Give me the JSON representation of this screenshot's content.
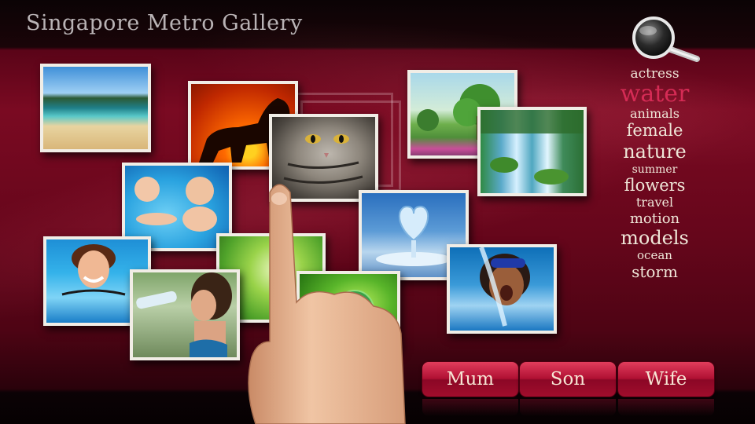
{
  "app": {
    "title": "Singapore Metro Gallery"
  },
  "search": {
    "icon": "magnifier-icon"
  },
  "photos": [
    {
      "name": "photo-beach",
      "icon": "beach-photo"
    },
    {
      "name": "photo-lion-sunset",
      "icon": "lion-photo"
    },
    {
      "name": "photo-cat",
      "icon": "cat-photo"
    },
    {
      "name": "photo-painting-trees",
      "icon": "trees-painting-photo"
    },
    {
      "name": "photo-waterfall",
      "icon": "waterfall-photo"
    },
    {
      "name": "photo-babies-pool",
      "icon": "babies-photo"
    },
    {
      "name": "photo-water-heart",
      "icon": "water-heart-photo"
    },
    {
      "name": "photo-woman-pool",
      "icon": "woman-pool-photo"
    },
    {
      "name": "photo-green-glass",
      "icon": "green-glass-photo"
    },
    {
      "name": "photo-woman-drinking",
      "icon": "woman-drinking-photo"
    },
    {
      "name": "photo-water-drop-leaf",
      "icon": "water-drop-photo"
    },
    {
      "name": "photo-girl-splash",
      "icon": "girl-splash-photo"
    }
  ],
  "tags": [
    {
      "label": "actress",
      "highlight": false
    },
    {
      "label": "water",
      "highlight": true
    },
    {
      "label": "animals",
      "highlight": false
    },
    {
      "label": "female",
      "highlight": false
    },
    {
      "label": "nature",
      "highlight": false
    },
    {
      "label": "summer",
      "highlight": false
    },
    {
      "label": "flowers",
      "highlight": false
    },
    {
      "label": "travel",
      "highlight": false
    },
    {
      "label": "motion",
      "highlight": false
    },
    {
      "label": "models",
      "highlight": false
    },
    {
      "label": "ocean",
      "highlight": false
    },
    {
      "label": "storm",
      "highlight": false
    }
  ],
  "buttons": [
    {
      "label": "Mum"
    },
    {
      "label": "Son"
    },
    {
      "label": "Wife"
    }
  ],
  "colors": {
    "background": "#6e0a22",
    "tag_text": "#efe6d8",
    "tag_highlight": "#d52b55",
    "button": "#b01033",
    "photo_frame": "#f1ede6"
  }
}
